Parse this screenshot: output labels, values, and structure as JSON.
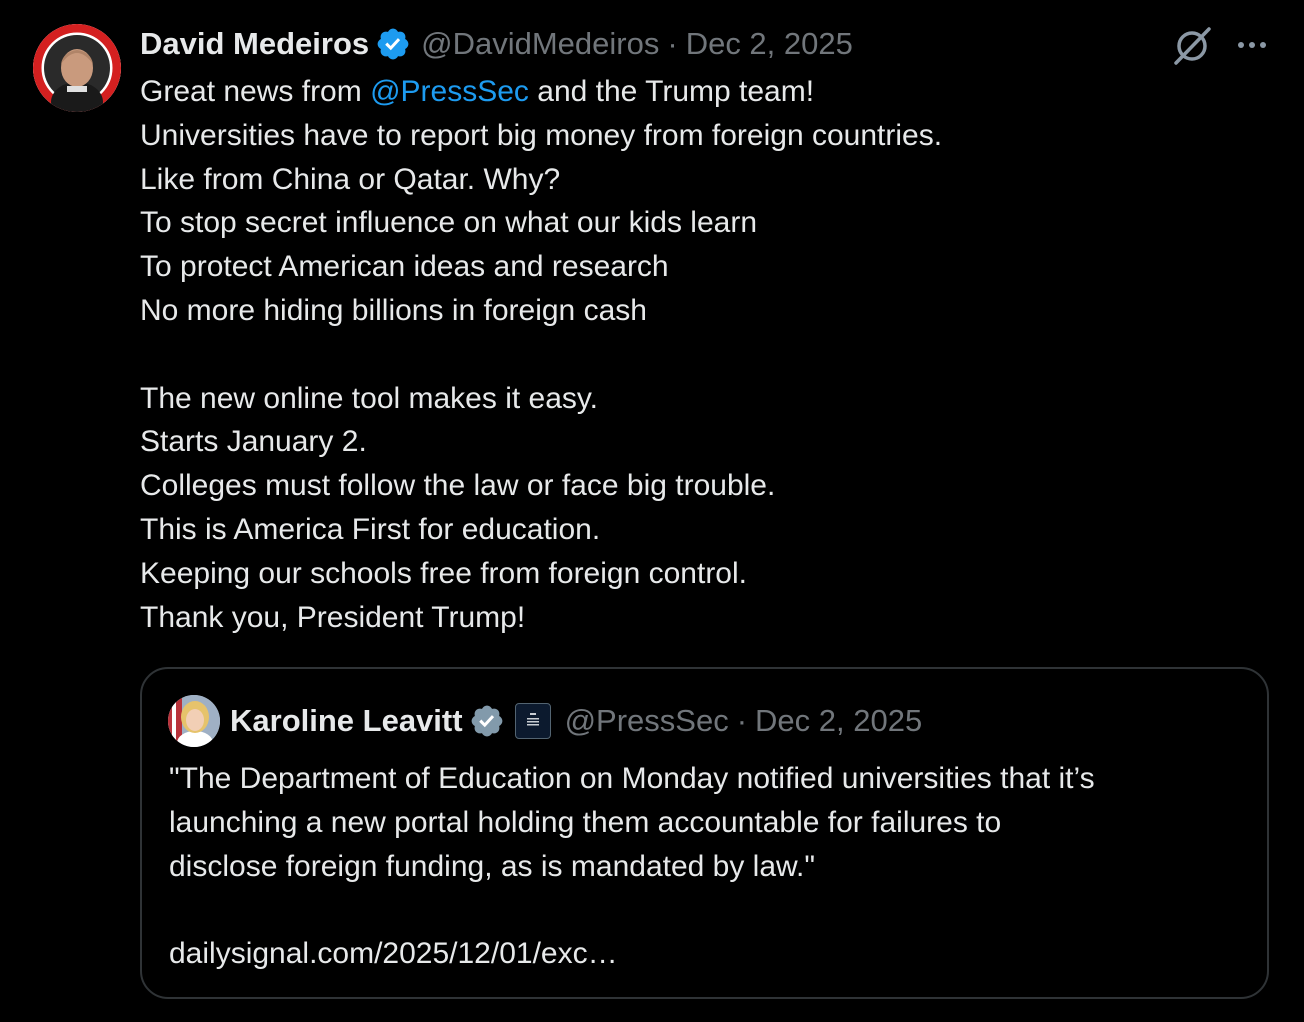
{
  "post": {
    "author": {
      "display_name": "David Medeiros",
      "handle": "@DavidMedeiros",
      "verified": true,
      "avatar_icon": "profile-avatar"
    },
    "separator": "·",
    "date": "Dec 2, 2025",
    "actions": {
      "grok_icon": "grok-slash-circle-icon",
      "more_icon": "more-dots-icon"
    },
    "text": {
      "line1_pre": "Great news from ",
      "line1_mention": "@PressSec",
      "line1_post": " and the Trump team!",
      "lines_a": [
        "Universities have to report big money from foreign countries.",
        "Like from China or Qatar.  Why?",
        "To stop secret influence on what our kids learn",
        "To protect American ideas and research",
        "No more hiding billions in foreign cash"
      ],
      "lines_b": [
        "The new online tool makes it easy.",
        "Starts January 2.",
        "Colleges must follow the law or face big trouble.",
        "This is America First for education.",
        "Keeping our schools free from foreign control.",
        "Thank you, President Trump!"
      ]
    },
    "quote": {
      "author": {
        "display_name": "Karoline Leavitt",
        "handle": "@PressSec",
        "verified": true,
        "verified_color": "#829aab",
        "affiliation_icon": "white-house-badge-icon"
      },
      "separator": "·",
      "date": "Dec 2, 2025",
      "lines": [
        "\"The Department of Education on Monday notified universities that it’s",
        "launching a new portal holding them accountable for failures to",
        "disclose foreign funding, as is mandated by law.\"",
        "",
        "dailysignal.com/2025/12/01/exc…"
      ]
    }
  },
  "colors": {
    "background": "#000000",
    "text": "#e7e9ea",
    "muted": "#71767b",
    "link": "#1d9bf0",
    "verified_blue": "#1d9bf0",
    "border": "#2f3336"
  }
}
